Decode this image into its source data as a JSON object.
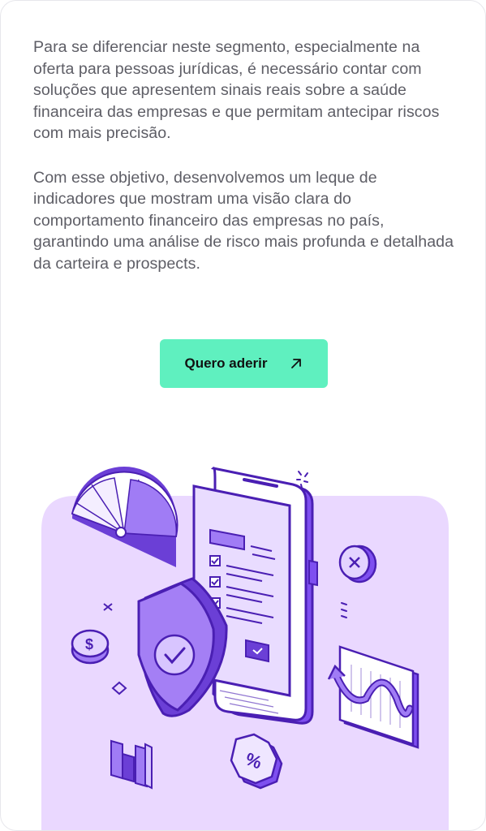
{
  "content": {
    "paragraphs": [
      "Para se diferenciar neste segmento, especialmente na oferta para pessoas jurídicas, é necessário contar com soluções que apresentem sinais reais sobre a saúde financeira das empresas e que permitam antecipar riscos com mais precisão.",
      "Com esse objetivo, desenvolvemos um leque de indicadores que mostram uma visão clara do comportamento financeiro das empresas no país, garantindo uma análise de risco mais profunda e detalhada da carteira e prospects."
    ]
  },
  "cta": {
    "label": "Quero aderir",
    "icon": "arrow-up-right-icon",
    "color": "#5ff0bf"
  },
  "illustration": {
    "percent_symbol": "%",
    "currency_symbol": "$",
    "accent_color": "#8a5cf5",
    "panel_color": "#ead8ff"
  }
}
